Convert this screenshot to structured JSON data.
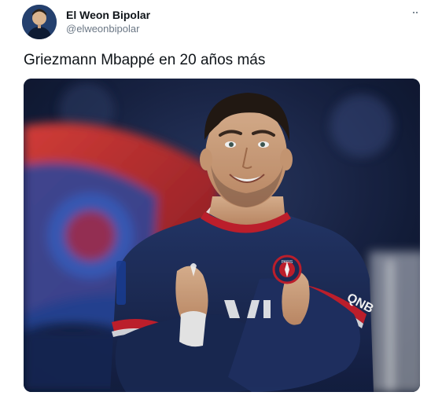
{
  "tweet": {
    "author": {
      "display_name": "El Weon Bipolar",
      "handle": "@elweonbipolar",
      "avatar_icon": "profile-photo-avatar"
    },
    "more_icon": "more-options-icon",
    "text": "Griezmann Mbappé en 20 años más",
    "media": {
      "type": "photo",
      "jersey_sponsor": "QNB",
      "jersey_crest_text": "PARIS"
    }
  },
  "colors": {
    "text_primary": "#0f1419",
    "text_secondary": "#6b7785",
    "background": "#ffffff",
    "jersey_navy": "#1c2d5a",
    "jersey_red": "#c8202e"
  }
}
